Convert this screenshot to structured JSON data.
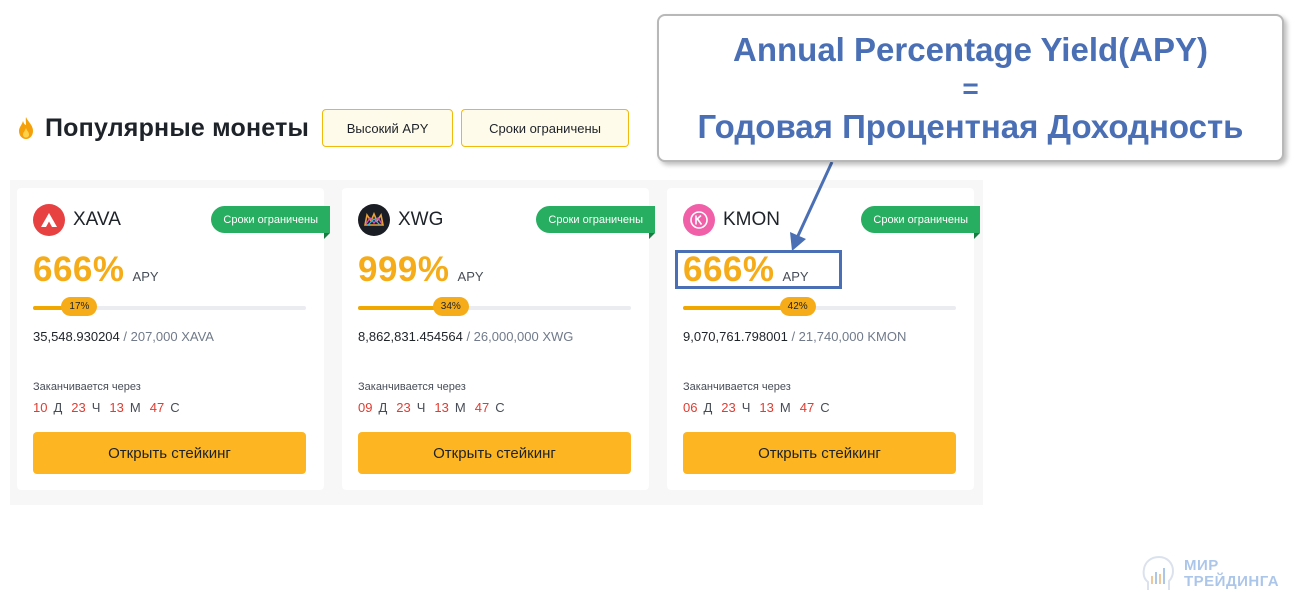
{
  "section": {
    "title": "Популярные монеты",
    "icon": "flame-icon",
    "filters": [
      "Высокий APY",
      "Сроки ограничены"
    ]
  },
  "cards": [
    {
      "coin": "XAVA",
      "icon": "avalaunch-logo-icon",
      "badge": "Сроки ограничены",
      "apy_value": "666%",
      "apy_label": "APY",
      "progress_text": "17%",
      "progress": 17,
      "amount_done": "35,548.930204",
      "amount_sep": " / ",
      "amount_total": "207,000 XAVA",
      "ends_label": "Заканчивается через",
      "countdown": {
        "d": "10",
        "d_unit": "Д",
        "h": "23",
        "h_unit": "Ч",
        "m": "13",
        "m_unit": "М",
        "s": "47",
        "s_unit": "С"
      },
      "button": "Открыть стейкинг"
    },
    {
      "coin": "XWG",
      "icon": "xwg-crown-logo-icon",
      "badge": "Сроки ограничены",
      "apy_value": "999%",
      "apy_label": "APY",
      "progress_text": "34%",
      "progress": 34,
      "amount_done": "8,862,831.454564",
      "amount_sep": " / ",
      "amount_total": "26,000,000 XWG",
      "ends_label": "Заканчивается через",
      "countdown": {
        "d": "09",
        "d_unit": "Д",
        "h": "23",
        "h_unit": "Ч",
        "m": "13",
        "m_unit": "М",
        "s": "47",
        "s_unit": "С"
      },
      "button": "Открыть стейкинг"
    },
    {
      "coin": "KMON",
      "icon": "kmon-logo-icon",
      "badge": "Сроки ограничены",
      "apy_value": "666%",
      "apy_label": "APY",
      "progress_text": "42%",
      "progress": 42,
      "amount_done": "9,070,761.798001",
      "amount_sep": " / ",
      "amount_total": "21,740,000 KMON",
      "ends_label": "Заканчивается через",
      "countdown": {
        "d": "06",
        "d_unit": "Д",
        "h": "23",
        "h_unit": "Ч",
        "m": "13",
        "m_unit": "М",
        "s": "47",
        "s_unit": "С"
      },
      "button": "Открыть стейкинг"
    }
  ],
  "callout": {
    "line1": "Annual Percentage Yield(APY)",
    "line2": "=",
    "line3": "Годовая Процентная Доходность"
  },
  "watermark": {
    "line1": "МИР",
    "line2": "ТРЕЙДИНГА",
    "icon": "head-chart-logo-icon"
  },
  "colors": {
    "accent": "#f5ac18",
    "button": "#fdb622",
    "badge_green": "#27ae60",
    "countdown_red": "#e03c31",
    "annotation_blue": "#4a6fb5"
  }
}
